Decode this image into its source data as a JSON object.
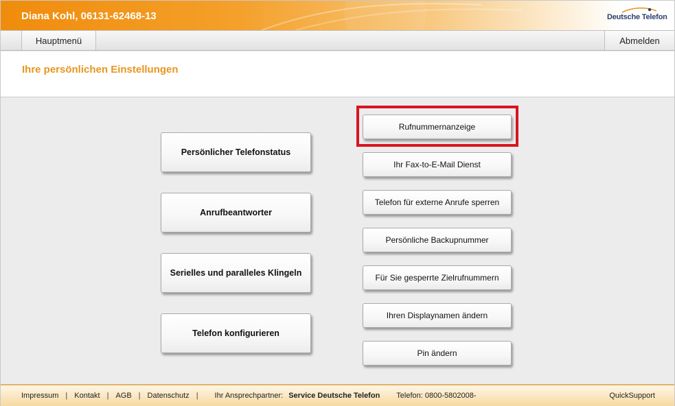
{
  "header": {
    "user_line": "Diana Kohl, 06131-62468-13",
    "logo_text": "Deutsche Telefon"
  },
  "nav": {
    "main_menu": "Hauptmenü",
    "logout": "Abmelden"
  },
  "page": {
    "title": "Ihre persönlichen Einstellungen"
  },
  "left_buttons": [
    "Persönlicher Telefonstatus",
    "Anrufbeantworter",
    "Serielles und paralleles Klingeln",
    "Telefon konfigurieren"
  ],
  "right_buttons": [
    "Rufnummernanzeige",
    "Ihr Fax-to-E-Mail Dienst",
    "Telefon für externe Anrufe sperren",
    "Persönliche Backupnummer",
    "Für Sie gesperrte Zielrufnummern",
    "Ihren Displaynamen ändern",
    "Pin ändern"
  ],
  "footer": {
    "links": [
      "Impressum",
      "Kontakt",
      "AGB",
      "Datenschutz"
    ],
    "partner_label": "Ihr Ansprechpartner:",
    "partner_name": "Service Deutsche Telefon",
    "phone": "Telefon: 0800-5802008-",
    "quicksupport": "QuickSupport"
  },
  "colors": {
    "header_orange": "#f08c0c",
    "title_orange": "#e8961e",
    "highlight_red": "#d9141f",
    "logo_blue": "#2a3f6e"
  },
  "icons": {
    "logo": "deutsche-telefon-logo-arc"
  }
}
